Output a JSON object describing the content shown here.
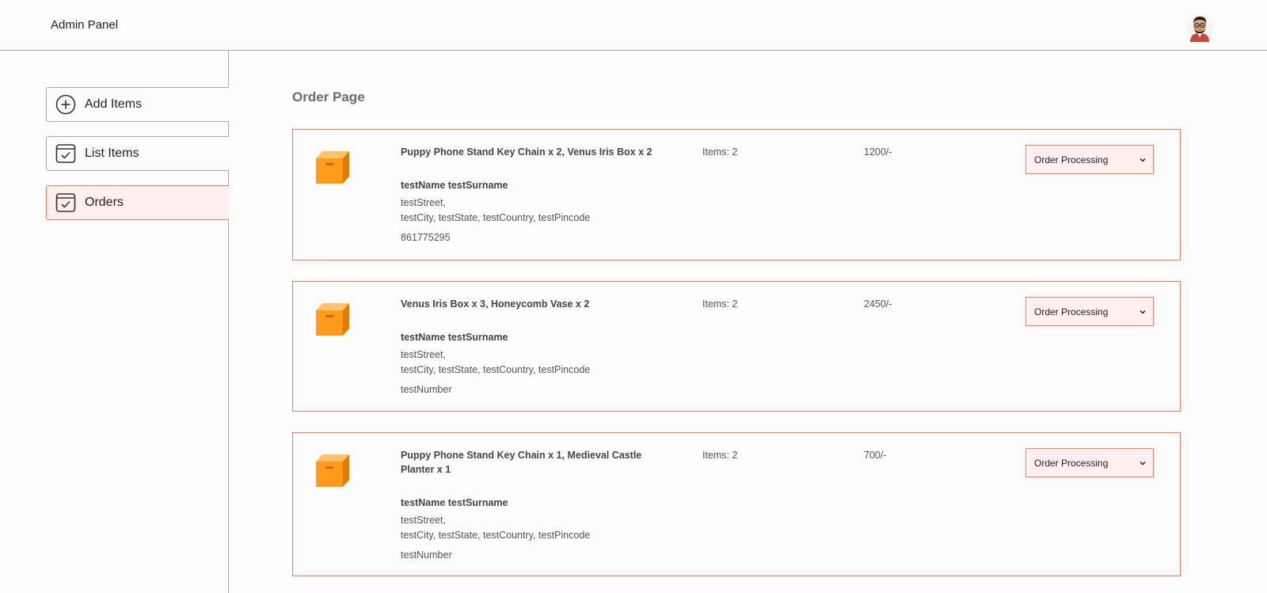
{
  "header": {
    "title": "Admin Panel",
    "avatar_icon": "profile-avatar-icon"
  },
  "sidebar": {
    "items": [
      {
        "label": "Add Items",
        "icon": "add-circle-icon"
      },
      {
        "label": "List Items",
        "icon": "checklist-icon"
      },
      {
        "label": "Orders",
        "icon": "checklist-icon",
        "active": true
      }
    ]
  },
  "main": {
    "title": "Order Page",
    "orders": [
      {
        "items": "Puppy Phone Stand Key Chain x 2, Venus Iris Box x 2",
        "name": "testName testSurname",
        "street": "testStreet,",
        "city_line": "testCity, testState, testCountry, testPincode",
        "phone": "861775295",
        "count": "Items: 2",
        "amount": "1200/-",
        "status": "Order Processing"
      },
      {
        "items": "Venus Iris Box x 3, Honeycomb Vase x 2",
        "name": "testName testSurname",
        "street": "testStreet,",
        "city_line": "testCity, testState, testCountry, testPincode",
        "phone": "testNumber",
        "count": "Items: 2",
        "amount": "2450/-",
        "status": "Order Processing"
      },
      {
        "items": "Puppy Phone Stand Key Chain x 1, Medieval Castle Planter x 1",
        "name": "testName testSurname",
        "street": "testStreet,",
        "city_line": "testCity, testState, testCountry, testPincode",
        "phone": "testNumber",
        "count": "Items: 2",
        "amount": "700/-",
        "status": "Order Processing"
      }
    ]
  },
  "colors": {
    "accent": "#f07a60",
    "accent_bg": "#fff0ed",
    "box": "#ff9a1a"
  }
}
